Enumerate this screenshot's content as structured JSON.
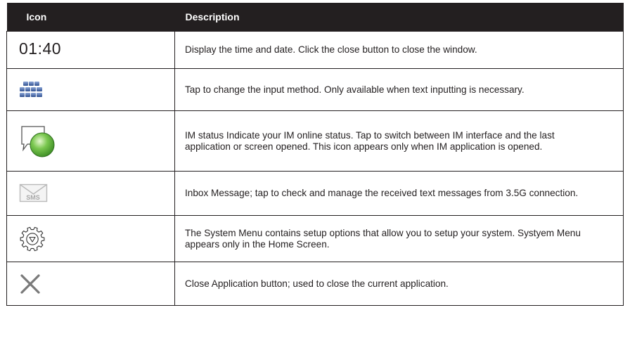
{
  "table": {
    "headers": {
      "icon": "Icon",
      "description": "Description"
    },
    "rows": [
      {
        "icon": "clock-time",
        "icon_text": "01:40",
        "description": "Display the time and date. Click the close button to close the window."
      },
      {
        "icon": "keyboard-icon",
        "description": "Tap to change the input method. Only available when text inputting is necessary."
      },
      {
        "icon": "im-status-icon",
        "description": "IM status Indicate your IM online status. Tap to switch between IM interface and the last application or screen opened. This icon appears only when IM application is opened."
      },
      {
        "icon": "sms-envelope-icon",
        "icon_text": "SMS",
        "description": "Inbox Message; tap to check and manage the received text messages from 3.5G connection."
      },
      {
        "icon": "system-menu-gear-icon",
        "description": "The System Menu contains setup options that allow you to setup your system. Systyem Menu appears only in the Home Screen."
      },
      {
        "icon": "close-icon",
        "description": "Close Application button; used to close the current application."
      }
    ]
  }
}
